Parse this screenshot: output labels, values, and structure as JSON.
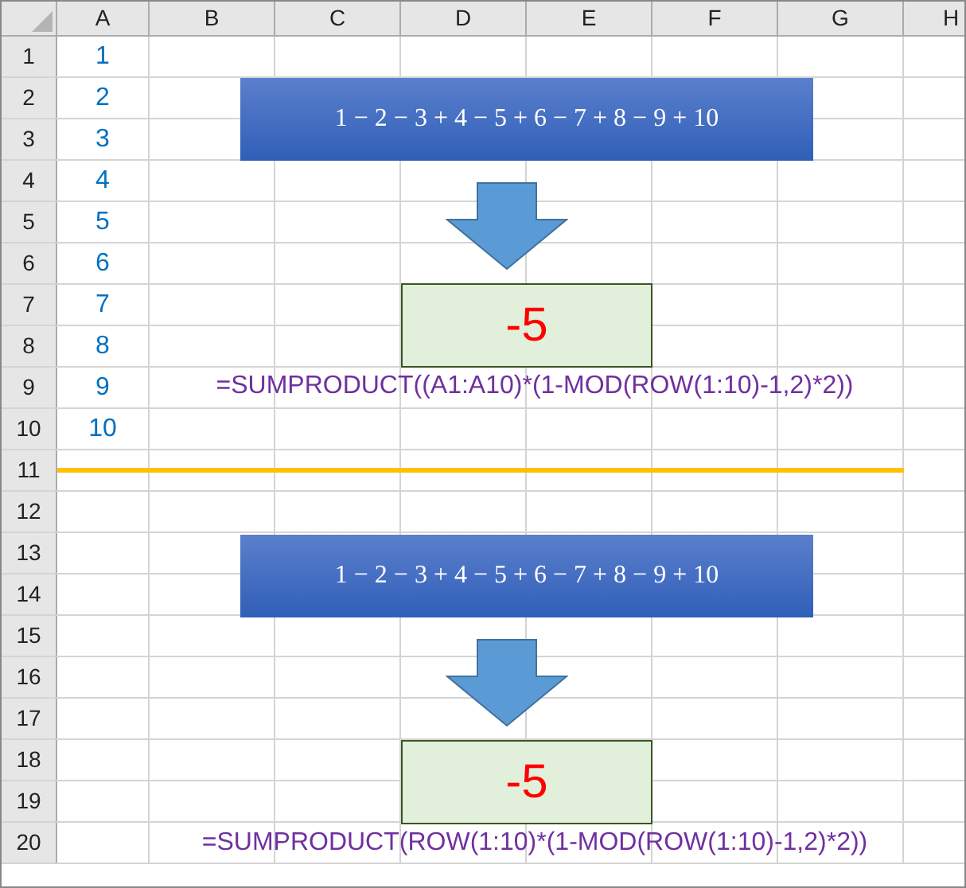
{
  "columns": [
    "A",
    "B",
    "C",
    "D",
    "E",
    "F",
    "G",
    "H"
  ],
  "rows": [
    {
      "label": "1",
      "a": "1"
    },
    {
      "label": "2",
      "a": "2"
    },
    {
      "label": "3",
      "a": "3"
    },
    {
      "label": "4",
      "a": "4"
    },
    {
      "label": "5",
      "a": "5"
    },
    {
      "label": "6",
      "a": "6"
    },
    {
      "label": "7",
      "a": "7"
    },
    {
      "label": "8",
      "a": "8"
    },
    {
      "label": "9",
      "a": "9"
    },
    {
      "label": "10",
      "a": "10"
    },
    {
      "label": "11"
    },
    {
      "label": "12"
    },
    {
      "label": "13"
    },
    {
      "label": "14"
    },
    {
      "label": "15"
    },
    {
      "label": "16"
    },
    {
      "label": "17"
    },
    {
      "label": "18"
    },
    {
      "label": "19"
    },
    {
      "label": "20"
    }
  ],
  "examples": [
    {
      "expression": "1 − 2 − 3 + 4 − 5 + 6 − 7 + 8 − 9 + 10",
      "result": "-5",
      "formula": "=SUMPRODUCT((A1:A10)*(1-MOD(ROW(1:10)-1,2)*2))"
    },
    {
      "expression": "1 − 2 − 3 + 4 − 5 + 6 − 7 + 8 − 9 + 10",
      "result": "-5",
      "formula": "=SUMPRODUCT(ROW(1:10)*(1-MOD(ROW(1:10)-1,2)*2))"
    }
  ]
}
